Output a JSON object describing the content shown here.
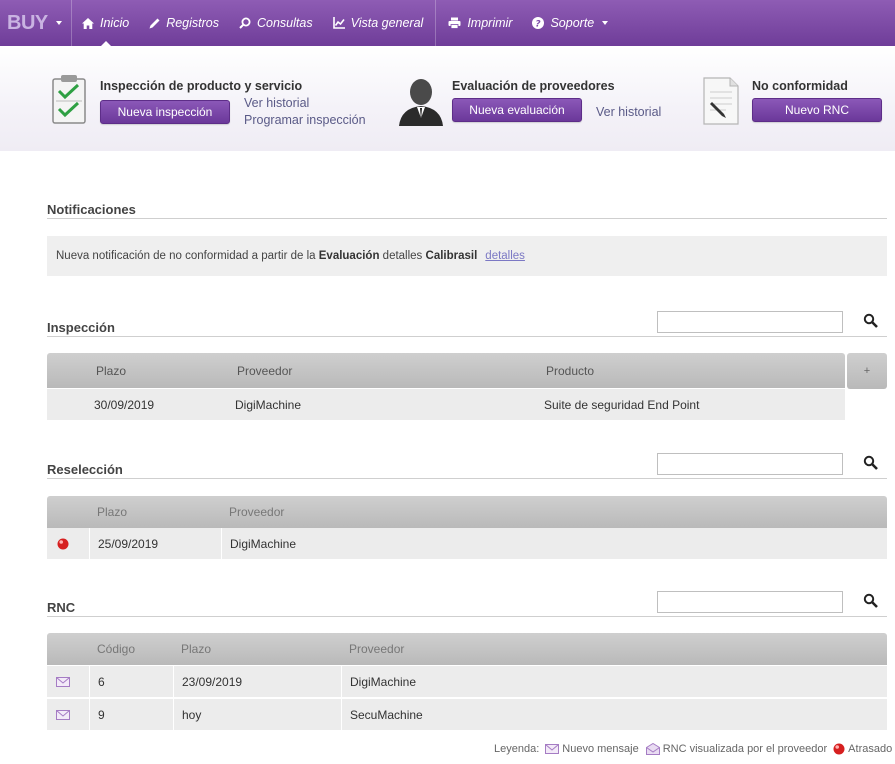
{
  "nav": {
    "brand": "BUY",
    "items": [
      {
        "label": "Inicio",
        "icon": "home-icon"
      },
      {
        "label": "Registros",
        "icon": "pencil-icon"
      },
      {
        "label": "Consultas",
        "icon": "search-icon"
      },
      {
        "label": "Vista general",
        "icon": "chart-icon"
      },
      {
        "label": "Imprimir",
        "icon": "printer-icon"
      },
      {
        "label": "Soporte",
        "icon": "help-icon"
      }
    ]
  },
  "quick": {
    "inspection": {
      "title": "Inspección de producto y servicio",
      "button": "Nueva inspección",
      "link1": "Ver historial",
      "link2": "Programar inspección"
    },
    "evaluation": {
      "title": "Evaluación de proveedores",
      "button": "Nueva evaluación",
      "link1": "Ver historial"
    },
    "nonconformity": {
      "title": "No conformidad",
      "button": "Nuevo RNC"
    }
  },
  "notifications": {
    "title": "Notificaciones",
    "text_before": "Nueva notificación de no conformidad a partir de la",
    "bold1": "Evaluación",
    "text_middle": "detalles",
    "bold2": "Calibrasil",
    "link": "detalles"
  },
  "inspection": {
    "title": "Inspección",
    "search_placeholder": "",
    "plus": "+",
    "headers": [
      "Plazo",
      "Proveedor",
      "Producto"
    ],
    "rows": [
      {
        "plazo": "30/09/2019",
        "proveedor": "DigiMachine",
        "producto": "Suite de seguridad End Point"
      }
    ]
  },
  "reselection": {
    "title": "Reselección",
    "search_placeholder": "",
    "headers": [
      "Plazo",
      "Proveedor"
    ],
    "rows": [
      {
        "status": "atrasado",
        "plazo": "25/09/2019",
        "proveedor": "DigiMachine"
      }
    ]
  },
  "rnc": {
    "title": "RNC",
    "search_placeholder": "",
    "headers": [
      "Código",
      "Plazo",
      "Proveedor"
    ],
    "rows": [
      {
        "icon": "mail-icon",
        "codigo": "6",
        "plazo": "23/09/2019",
        "proveedor": "DigiMachine"
      },
      {
        "icon": "mail-icon",
        "codigo": "9",
        "plazo": "hoy",
        "proveedor": "SecuMachine"
      }
    ]
  },
  "legend": {
    "label": "Leyenda:",
    "new_message": "Nuevo mensaje",
    "viewed": "RNC visualizada por el proveedor",
    "late": "Atrasado"
  },
  "colors": {
    "nav_top": "#8e5cb4",
    "nav_bottom": "#6f3d99",
    "button": "#7a47a8",
    "late_red": "#d61f1f"
  }
}
